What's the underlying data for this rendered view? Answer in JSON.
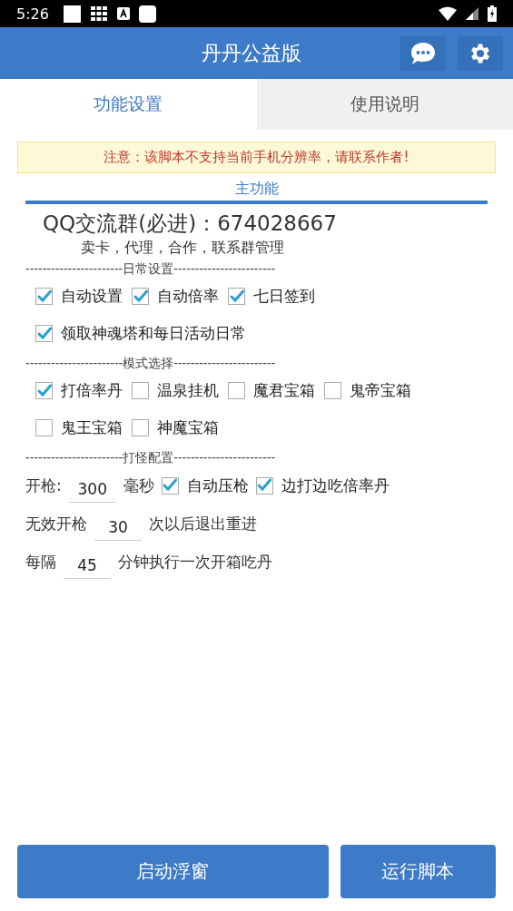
{
  "status_bar": {
    "time": "5:26"
  },
  "app_bar": {
    "title": "丹丹公益版"
  },
  "tabs": [
    {
      "label": "功能设置",
      "selected": true
    },
    {
      "label": "使用说明",
      "selected": false
    }
  ],
  "notice": "注意：该脚本不支持当前手机分辨率，请联系作者!",
  "section_title": "主功能",
  "qq_group": "QQ交流群(必进)：674028667",
  "contact_line": "卖卡，代理，合作，联系群管理",
  "sections": [
    {
      "divider": "-----------------------日常设置------------------------",
      "rows": [
        [
          {
            "kind": "checkbox",
            "label": "自动设置",
            "checked": true
          },
          {
            "kind": "checkbox",
            "label": "自动倍率",
            "checked": true
          },
          {
            "kind": "checkbox",
            "label": "七日签到",
            "checked": true
          }
        ],
        [
          {
            "kind": "checkbox",
            "label": "领取神魂塔和每日活动日常",
            "checked": true
          }
        ]
      ]
    },
    {
      "divider": "-----------------------模式选择------------------------",
      "rows": [
        [
          {
            "kind": "checkbox",
            "label": "打倍率丹",
            "checked": true
          },
          {
            "kind": "checkbox",
            "label": "温泉挂机",
            "checked": false
          },
          {
            "kind": "checkbox",
            "label": "魔君宝箱",
            "checked": false
          },
          {
            "kind": "checkbox",
            "label": "鬼帝宝箱",
            "checked": false
          }
        ],
        [
          {
            "kind": "checkbox",
            "label": "鬼王宝箱",
            "checked": false
          },
          {
            "kind": "checkbox",
            "label": "神魔宝箱",
            "checked": false
          }
        ]
      ]
    },
    {
      "divider": "-----------------------打怪配置------------------------",
      "rows": [
        [
          {
            "kind": "text",
            "text": "开枪:"
          },
          {
            "kind": "input",
            "value": "300"
          },
          {
            "kind": "text",
            "text": "毫秒"
          },
          {
            "kind": "checkbox",
            "label": "自动压枪",
            "checked": true
          },
          {
            "kind": "checkbox",
            "label": "边打边吃倍率丹",
            "checked": true
          }
        ],
        [
          {
            "kind": "text",
            "text": "无效开枪"
          },
          {
            "kind": "input",
            "value": "30"
          },
          {
            "kind": "text",
            "text": "次以后退出重进"
          }
        ],
        [
          {
            "kind": "text",
            "text": "每隔"
          },
          {
            "kind": "input",
            "value": "45"
          },
          {
            "kind": "text",
            "text": "分钟执行一次开箱吃丹"
          }
        ]
      ]
    }
  ],
  "buttons": [
    "启动浮窗",
    "运行脚本"
  ]
}
